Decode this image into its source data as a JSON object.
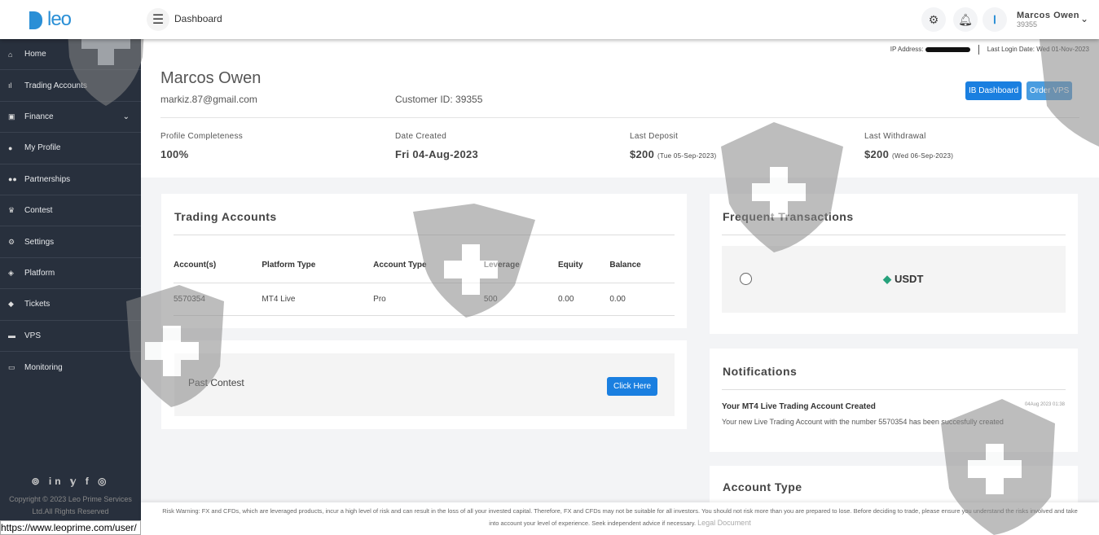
{
  "header": {
    "logo": "leo",
    "title": "Dashboard",
    "user_name": "Marcos Owen",
    "user_id": "39355"
  },
  "sidebar": {
    "items": [
      {
        "label": "Home",
        "icon": "home-icon"
      },
      {
        "label": "Trading Accounts",
        "icon": "chart-icon"
      },
      {
        "label": "Finance",
        "icon": "wallet-icon"
      },
      {
        "label": "My Profile",
        "icon": "user-icon"
      },
      {
        "label": "Partnerships",
        "icon": "users-icon"
      },
      {
        "label": "Contest",
        "icon": "trophy-icon"
      },
      {
        "label": "Settings",
        "icon": "gear-icon"
      },
      {
        "label": "Platform",
        "icon": "layers-icon"
      },
      {
        "label": "Tickets",
        "icon": "ticket-icon"
      },
      {
        "label": "VPS",
        "icon": "server-icon"
      },
      {
        "label": "Monitoring",
        "icon": "monitor-icon"
      }
    ],
    "social": "⊚ in 𝕪 f ◎",
    "copyright1": "Copyright © 2023 Leo Prime Services",
    "copyright2": "Ltd.All Rights Reserved"
  },
  "status_url": "https://www.leoprime.com/user/",
  "profile": {
    "ip_label": "IP Address:",
    "last_login": "Last Login Date: Wed 01-Nov-2023",
    "name": "Marcos Owen",
    "email": "markiz.87@gmail.com",
    "customer_id": "Customer ID: 39355",
    "ib_button": "IB Dashboard",
    "vps_button": "Order VPS",
    "stats": [
      {
        "label": "Profile Completeness",
        "value": "100%",
        "sub": ""
      },
      {
        "label": "Date Created",
        "value": "Fri 04-Aug-2023",
        "sub": ""
      },
      {
        "label": "Last Deposit",
        "value": "$200",
        "sub": "(Tue 05-Sep-2023)"
      },
      {
        "label": "Last Withdrawal",
        "value": "$200",
        "sub": "(Wed 06-Sep-2023)"
      }
    ]
  },
  "trading": {
    "title": "Trading Accounts",
    "columns": [
      "Account(s)",
      "Platform Type",
      "Account Type",
      "Leverage",
      "Equity",
      "Balance"
    ],
    "rows": [
      [
        "5570354",
        "MT4 Live",
        "Pro",
        "500",
        "0.00",
        "0.00"
      ]
    ]
  },
  "contest": {
    "label": "Past Contest",
    "button": "Click Here"
  },
  "frequent": {
    "title": "Frequent Transactions",
    "item": "USDT"
  },
  "notifications": {
    "title": "Notifications",
    "items": [
      {
        "title": "Your MT4 Live Trading Account Created",
        "time": "04Aug 2023 01:38",
        "body": "Your new Live Trading Account with the number 5570354 has been succesfully created"
      }
    ]
  },
  "account_type": {
    "title": "Account Type"
  },
  "footer": {
    "warning": "Risk Warning: FX and CFDs, which are leveraged products, incur a high level of risk and can result in the loss of all your invested capital. Therefore, FX and CFDs may not be suitable for all investors. You should not risk more than you are prepared to lose. Before deciding to trade, please ensure you understand the risks involved and take into account your level of experience. Seek independent advice if necessary.",
    "legal": "Legal Document"
  }
}
